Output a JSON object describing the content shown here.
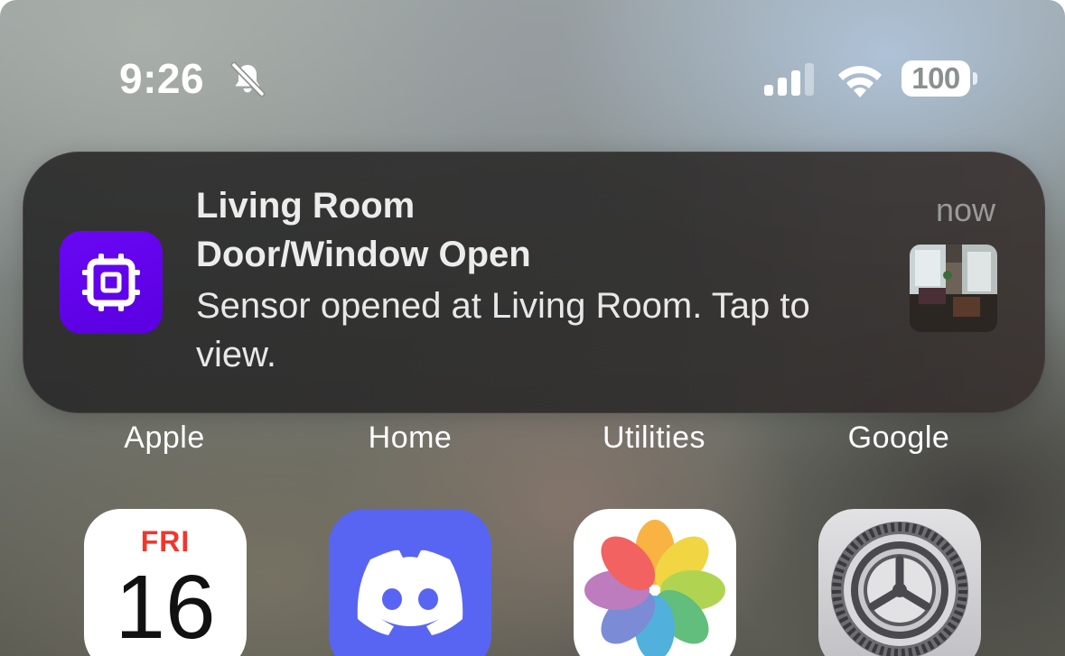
{
  "status_bar": {
    "time": "9:26",
    "battery_level": "100",
    "icons": [
      "bell-slash-icon",
      "cellular-signal-icon",
      "wifi-icon",
      "battery-icon"
    ]
  },
  "notification": {
    "title": "Living Room",
    "subtitle": "Door/Window Open",
    "body": "Sensor opened at Living Room. Tap to view.",
    "time": "now",
    "app_icon": "chip-icon",
    "app_icon_color": "#6200ee"
  },
  "folders": [
    {
      "label": "Apple"
    },
    {
      "label": "Home"
    },
    {
      "label": "Utilities"
    },
    {
      "label": "Google"
    }
  ],
  "apps": {
    "calendar": {
      "day": "FRI",
      "date": "16"
    },
    "discord": {
      "icon": "discord-icon",
      "color": "#5865f2"
    },
    "photos": {
      "icon": "photos-icon"
    },
    "settings": {
      "icon": "gear-icon"
    }
  }
}
